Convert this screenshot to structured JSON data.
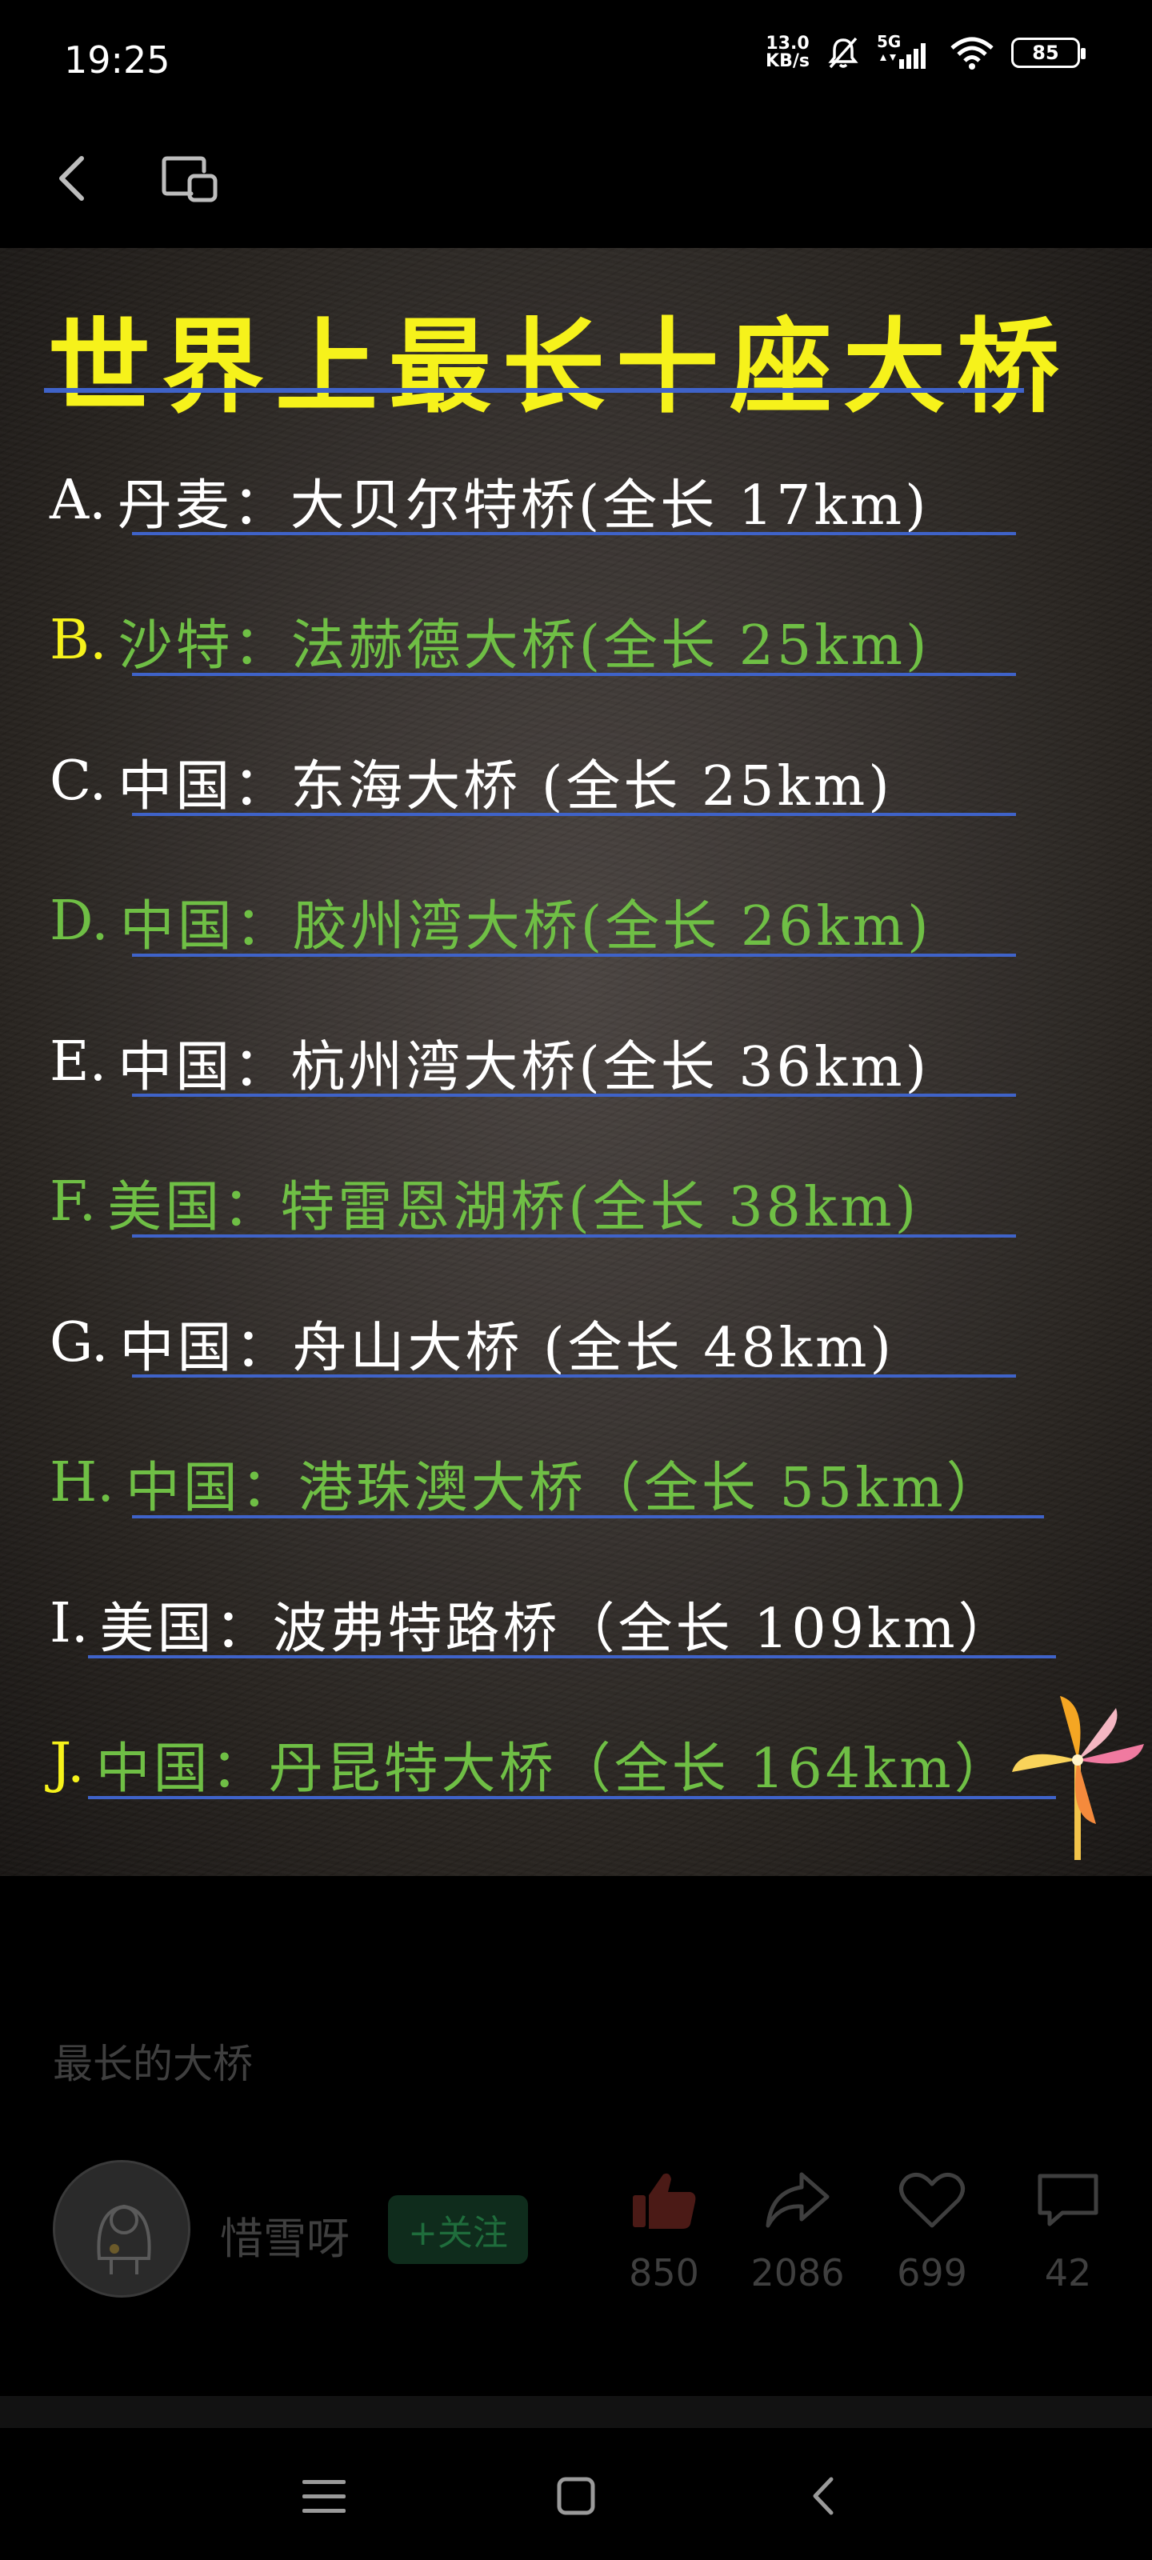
{
  "status_bar": {
    "time": "19:25",
    "net_speed_value": "13.0",
    "net_speed_unit": "KB/s",
    "network_type": "5G",
    "battery_level": "85",
    "icons": [
      "mute-bell-icon",
      "signal-icon",
      "wifi-icon",
      "battery-icon"
    ]
  },
  "top_nav": {
    "icons": [
      "back-chevron-icon",
      "floating-window-icon"
    ]
  },
  "poster": {
    "title": "世界上最长十座大桥",
    "colors": {
      "title": "#f6f21b",
      "white": "#ffffff",
      "green": "#6fbf45",
      "yellow": "#f6f21b",
      "underline": "#3f63c9"
    },
    "rows": [
      {
        "letter": "A.",
        "text": "丹麦：大贝尔特桥(全长 17km)",
        "color": "#ffffff",
        "letter_color": "#ffffff"
      },
      {
        "letter": "B.",
        "text": "沙特：法赫德大桥(全长 25km)",
        "color": "#6fbf45",
        "letter_color": "#f6f21b"
      },
      {
        "letter": "C.",
        "text": "中国：东海大桥  (全长 25km)",
        "color": "#ffffff",
        "letter_color": "#ffffff"
      },
      {
        "letter": "D.",
        "text": "中国：胶州湾大桥(全长 26km)",
        "color": "#6fbf45",
        "letter_color": "#6fbf45"
      },
      {
        "letter": "E.",
        "text": "中国：杭州湾大桥(全长 36km)",
        "color": "#ffffff",
        "letter_color": "#ffffff"
      },
      {
        "letter": "F.",
        "text": "美国：特雷恩湖桥(全长 38km)",
        "color": "#6fbf45",
        "letter_color": "#6fbf45"
      },
      {
        "letter": "G.",
        "text": "中国：舟山大桥  (全长 48km)",
        "color": "#ffffff",
        "letter_color": "#ffffff"
      },
      {
        "letter": "H.",
        "text": "中国：港珠澳大桥（全长 55km）",
        "color": "#6fbf45",
        "letter_color": "#6fbf45"
      },
      {
        "letter": "I.",
        "text": "美国：波弗特路桥（全长 109km）",
        "color": "#ffffff",
        "letter_color": "#ffffff"
      },
      {
        "letter": "J.",
        "text": "中国：丹昆特大桥（全长 164km）",
        "color": "#6fbf45",
        "letter_color": "#f6f21b"
      }
    ]
  },
  "caption": "最长的大桥",
  "author": {
    "name": "惜雪呀",
    "follow_label": "+关注"
  },
  "stats": {
    "likes": "850",
    "shares": "2086",
    "favorites": "699",
    "comments": "42"
  },
  "bottom_nav": {
    "icons": [
      "menu-icon",
      "home-icon",
      "back-icon"
    ]
  }
}
